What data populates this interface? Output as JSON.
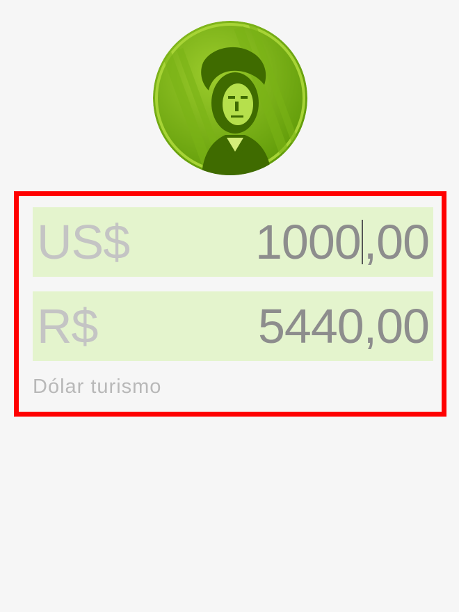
{
  "coin": {
    "icon": "dollar-coin-icon",
    "color": "#6aa70a"
  },
  "usd": {
    "currency_label": "US$",
    "amount_integer": "1000",
    "amount_decimal": ",00"
  },
  "brl": {
    "currency_label": "R$",
    "amount": "5440,00"
  },
  "hint": {
    "label": "Dólar turismo"
  },
  "colors": {
    "highlight_border": "#ff0000",
    "field_bg": "#e4f4cd",
    "coin_green": "#6aa70a"
  }
}
